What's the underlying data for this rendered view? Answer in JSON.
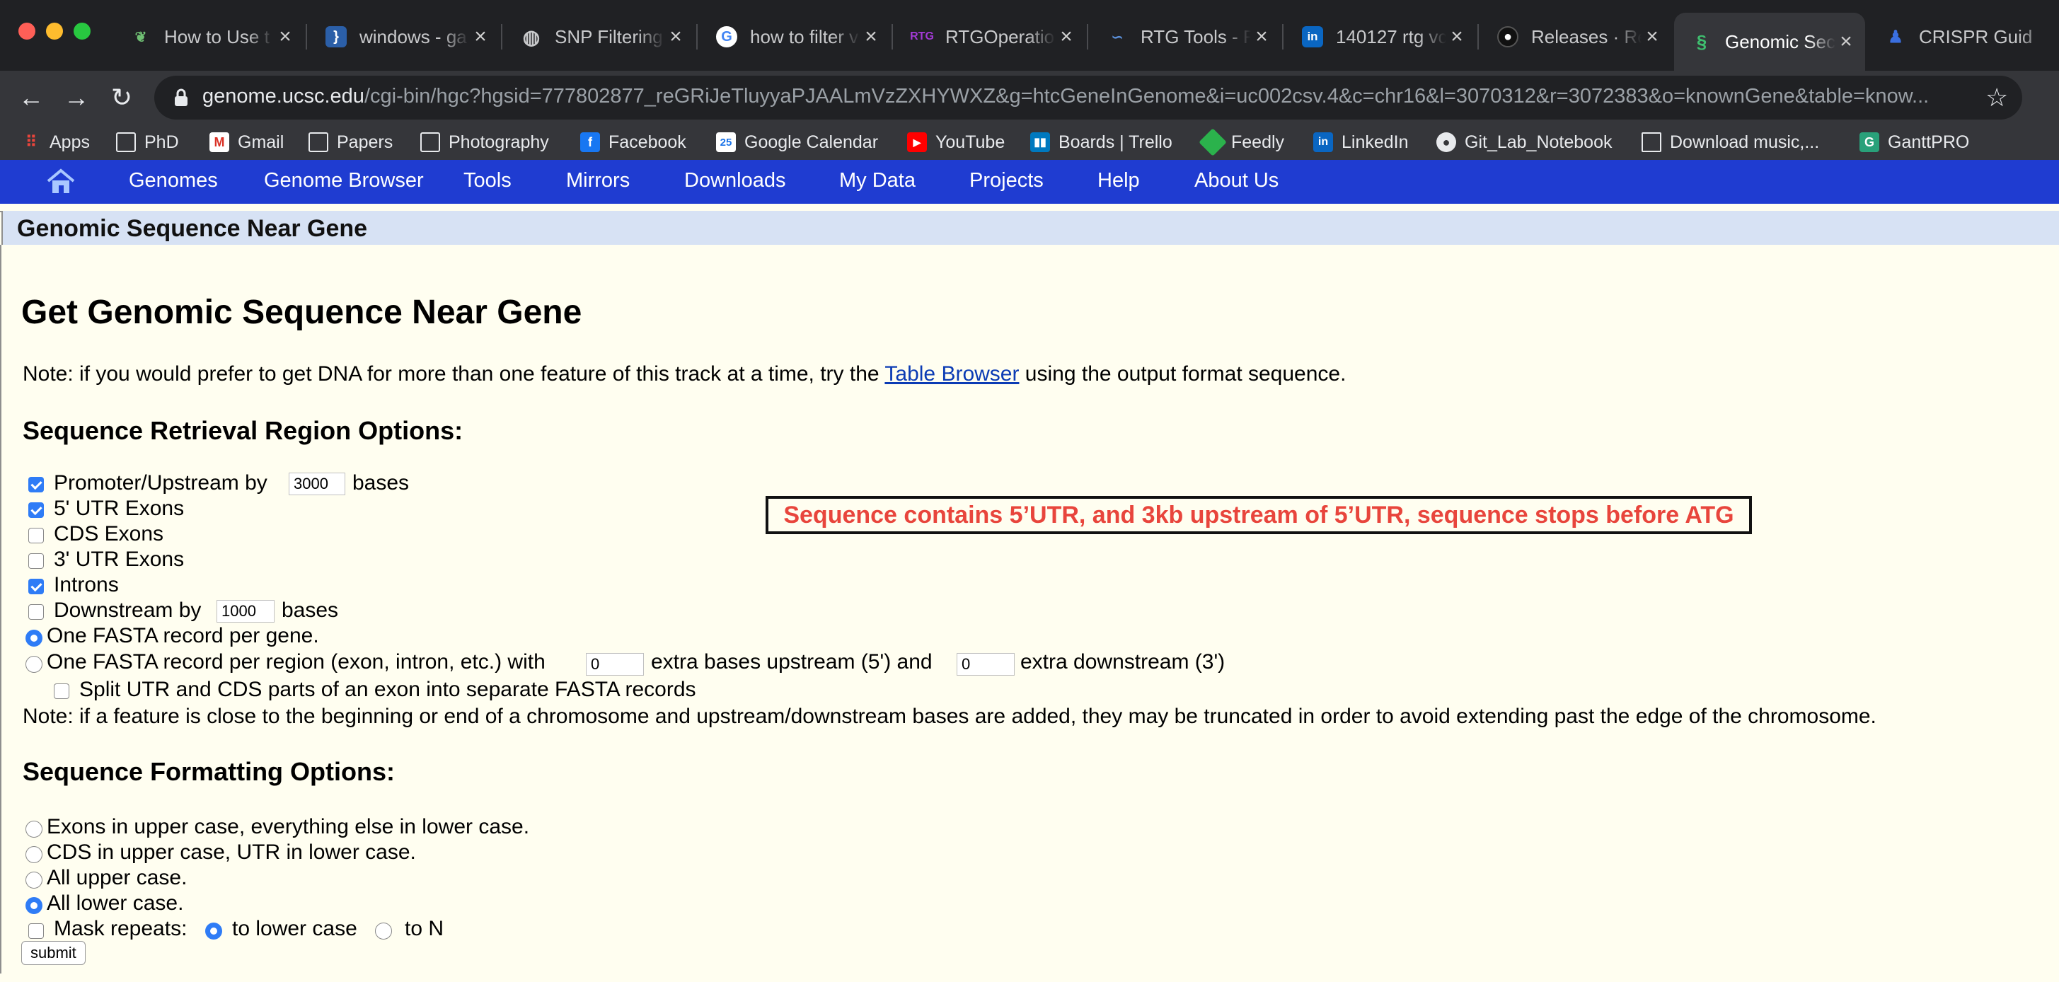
{
  "browser": {
    "tabs": [
      {
        "label": "How to Use t",
        "favicon": "leaf-icon"
      },
      {
        "label": "windows - ga",
        "favicon": "brackets-icon"
      },
      {
        "label": "SNP Filtering",
        "favicon": "globe-icon"
      },
      {
        "label": "how to filter v",
        "favicon": "google-icon"
      },
      {
        "label": "RTGOperatio",
        "favicon": "rtg-icon"
      },
      {
        "label": "RTG Tools - F",
        "favicon": "rtg-tools-icon"
      },
      {
        "label": "140127 rtg vc",
        "favicon": "linkedin-icon"
      },
      {
        "label": "Releases · Re",
        "favicon": "github-icon"
      },
      {
        "label": "Genomic Sec",
        "favicon": "dna-icon",
        "active": true
      },
      {
        "label": "CRISPR Guid",
        "favicon": "crispr-icon"
      }
    ],
    "url_host": "genome.ucsc.edu",
    "url_path": "/cgi-bin/hgc?hgsid=777802877_reGRiJeTluyyaPJAALmVzZXHYWXZ&g=htcGeneInGenome&i=uc002csv.4&c=chr16&l=3070312&r=3072383&o=knownGene&table=know...",
    "bookmarks": [
      "Apps",
      "PhD",
      "Gmail",
      "Papers",
      "Photography",
      "Facebook",
      "Google Calendar",
      "YouTube",
      "Boards | Trello",
      "Feedly",
      "LinkedIn",
      "Git_Lab_Notebook",
      "Download music,...",
      "GanttPRO"
    ]
  },
  "nav": {
    "items": [
      "Genomes",
      "Genome Browser",
      "Tools",
      "Mirrors",
      "Downloads",
      "My Data",
      "Projects",
      "Help",
      "About Us"
    ]
  },
  "page": {
    "section_title": "Genomic Sequence Near Gene",
    "heading": "Get Genomic Sequence Near Gene",
    "note_prefix": "Note: if you would prefer to get DNA for more than one feature of this track at a time, try the ",
    "note_link": "Table Browser",
    "note_suffix": " using the output format sequence.",
    "region_heading": "Sequence Retrieval Region Options:",
    "promoter_label": "Promoter/Upstream by",
    "promoter_value": "3000",
    "bases_label": "bases",
    "utr5_label": "5' UTR Exons",
    "cds_label": "CDS Exons",
    "utr3_label": "3' UTR Exons",
    "introns_label": "Introns",
    "downstream_label": "Downstream by",
    "downstream_value": "1000",
    "bases_label2": "bases",
    "one_per_gene": "One FASTA record per gene.",
    "per_region_prefix": "One FASTA record per region (exon, intron, etc.) with",
    "upstream_extra_value": "0",
    "per_region_mid": "extra bases upstream (5') and",
    "downstream_extra_value": "0",
    "per_region_suffix": "extra downstream (3')",
    "split_label": "Split UTR and CDS parts of an exon into separate FASTA records",
    "trunc_note": "Note: if a feature is close to the beginning or end of a chromosome and upstream/downstream bases are added, they may be truncated in order to avoid extending past the edge of the chromosome.",
    "format_heading": "Sequence Formatting Options:",
    "fmt_exons_upper": "Exons in upper case, everything else in lower case.",
    "fmt_cds_upper": "CDS in upper case, UTR in lower case.",
    "fmt_all_upper": "All upper case.",
    "fmt_all_lower": "All lower case.",
    "mask_label": "Mask repeats:",
    "mask_lower": "to lower case",
    "mask_n": "to N",
    "submit": "submit",
    "annotation": "Sequence contains 5’UTR, and 3kb upstream of 5’UTR, sequence stops before ATG"
  },
  "state": {
    "promoter_checked": true,
    "utr5_checked": true,
    "cds_checked": false,
    "utr3_checked": false,
    "introns_checked": true,
    "downstream_checked": false,
    "record_mode": "one_per_gene",
    "split_checked": false,
    "case_mode": "all_lower",
    "mask_checked": false,
    "mask_mode": "to_lower_case"
  },
  "colors": {
    "nav_bar": "#1f3cd1",
    "section_bar": "#d7e2f4",
    "page_bg": "#fffef0",
    "annotation_text": "#e8453c",
    "checkbox_blue": "#2f7cf6"
  }
}
